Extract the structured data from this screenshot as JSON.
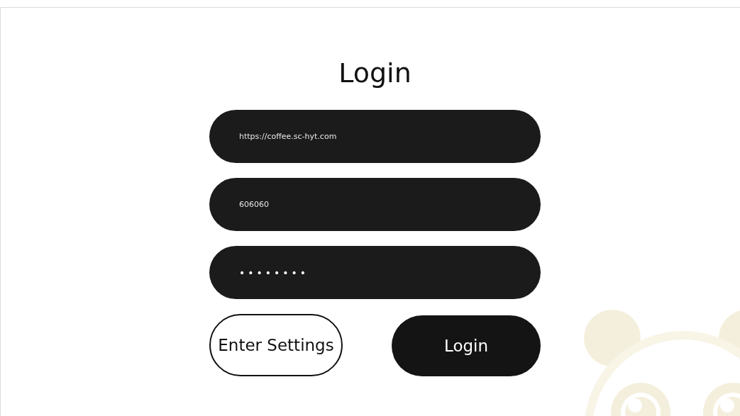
{
  "title": "Login",
  "fields": [
    {
      "kind": "text",
      "value": "https://coffee.sc-hyt.com"
    },
    {
      "kind": "text",
      "value": "606060"
    },
    {
      "kind": "password",
      "value": "••••••••"
    }
  ],
  "buttons": [
    {
      "kind": "outline",
      "label": "Enter Settings"
    },
    {
      "kind": "filled",
      "label": "Login"
    }
  ]
}
